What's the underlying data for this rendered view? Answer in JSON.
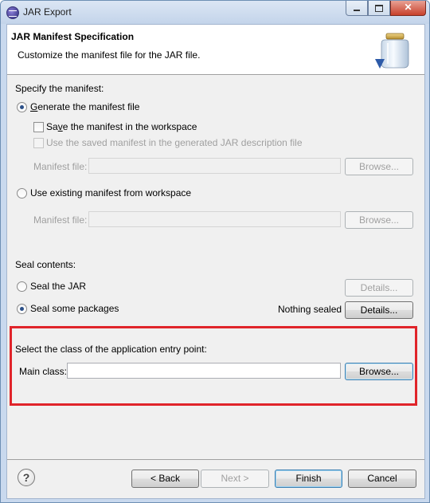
{
  "window": {
    "title": "JAR Export",
    "minimize_glyph": "",
    "close_glyph": "✕"
  },
  "header": {
    "title": "JAR Manifest Specification",
    "description": "Customize the manifest file for the JAR file."
  },
  "manifest": {
    "section_label": "Specify the manifest:",
    "generate_option": {
      "label": "Generate the manifest file",
      "mnemonic": "G",
      "checked": true
    },
    "save_in_workspace": {
      "label_pre": "Sa",
      "label_post": "e the manifest in the workspace",
      "mnemonic": "v",
      "checked": false
    },
    "use_saved": {
      "label": "Use the saved manifest in the generated JAR description file",
      "enabled": false
    },
    "manifest_file_1": {
      "label": "Manifest file:",
      "mnemonic": "M",
      "value": ""
    },
    "browse_1": "Browse...",
    "use_existing_option": {
      "label": "Use existing manifest from workspace",
      "mnemonic": "U",
      "checked": false
    },
    "manifest_file_2": {
      "label": "Manifest file:",
      "value": ""
    },
    "browse_2": "Browse..."
  },
  "seal": {
    "section_label": "Seal contents:",
    "seal_jar": {
      "label": "Seal the JAR",
      "checked": false
    },
    "details_1": "Details...",
    "seal_packages": {
      "label": "Seal some packages",
      "checked": true
    },
    "status": "Nothing sealed",
    "details_2": "Details..."
  },
  "entry_point": {
    "section_label": "Select the class of the application entry point:",
    "main_class_label": "Main class:",
    "main_class_value": "",
    "browse": "Browse..."
  },
  "footer": {
    "help_glyph": "?",
    "back": "< Back",
    "next": "Next >",
    "finish": "Finish",
    "cancel": "Cancel"
  },
  "colors": {
    "highlight_box": "#e0242a",
    "dialog_bg": "#f0f0f0",
    "header_bg": "#ffffff"
  }
}
